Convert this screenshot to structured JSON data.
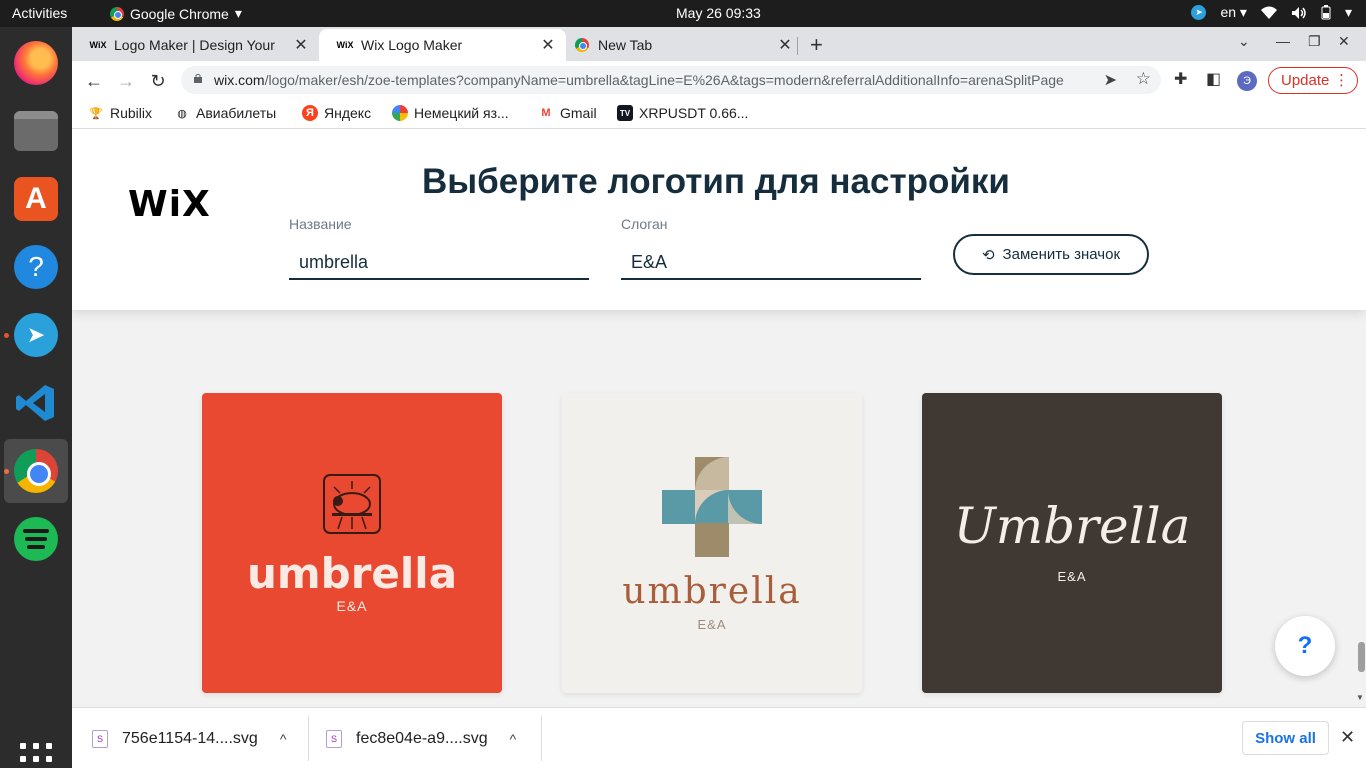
{
  "system": {
    "activities": "Activities",
    "app_name": "Google Chrome",
    "clock": "May 26  09:33",
    "lang": "en"
  },
  "tabs": [
    {
      "title": "Logo Maker | Design Your",
      "favicon": "WiX"
    },
    {
      "title": "Wix Logo Maker",
      "favicon": "WiX"
    },
    {
      "title": "New Tab",
      "favicon": "chrome-icon"
    }
  ],
  "address_bar": {
    "domain": "wix.com",
    "path": "/logo/maker/esh/zoe-templates?companyName=umbrella&tagLine=E%26A&tags=modern&referralAdditionalInfo=arenaSplitPage"
  },
  "profile_initial": "Э",
  "update_label": "Update",
  "bookmarks": [
    {
      "label": "Rubilix",
      "icon": "trophy-icon"
    },
    {
      "label": "Авиабилеты",
      "icon": "globe-icon"
    },
    {
      "label": "Яндекс",
      "icon": "yandex-icon"
    },
    {
      "label": "Немецкий яз...",
      "icon": "pinwheel-icon"
    },
    {
      "label": "Gmail",
      "icon": "gmail-icon"
    },
    {
      "label": "XRPUSDT 0.66...",
      "icon": "tradingview-icon"
    }
  ],
  "page": {
    "logo": "WiX",
    "title": "Выберите логотип для настройки",
    "name_label": "Название",
    "name_value": "umbrella",
    "slogan_label": "Слоган",
    "slogan_value": "E&A",
    "replace_icon_button": "Заменить значок",
    "help_label": "?"
  },
  "logo_cards": [
    {
      "name": "umbrella",
      "tagline": "E&A",
      "bg": "#e84930"
    },
    {
      "name": "umbrella",
      "tagline": "E&A",
      "bg": "#f2f0ec"
    },
    {
      "name": "Umbrella",
      "tagline": "E&A",
      "bg": "#403833"
    }
  ],
  "downloads": {
    "items": [
      {
        "filename": "756e1154-14....svg"
      },
      {
        "filename": "fec8e04e-a9....svg"
      }
    ],
    "show_all": "Show all"
  },
  "colors": {
    "accent": "#116dff",
    "title": "#162d3d",
    "update": "#d93025"
  }
}
